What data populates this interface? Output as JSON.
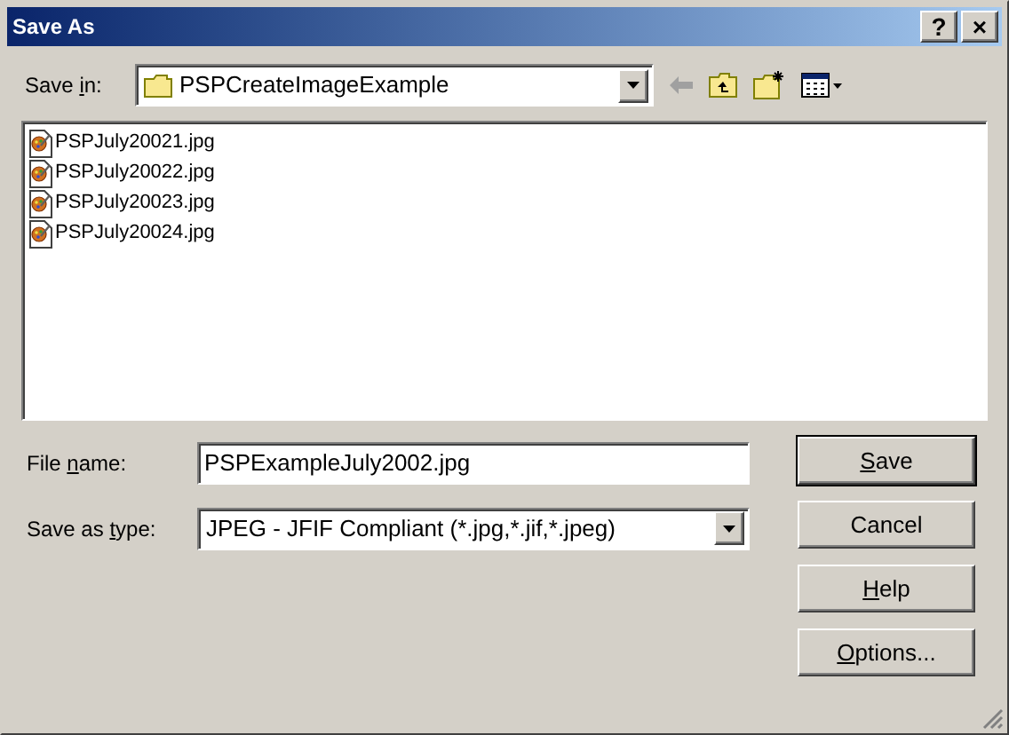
{
  "window": {
    "title": "Save As",
    "title_buttons": [
      "?",
      "×"
    ]
  },
  "save_in": {
    "label": {
      "before": "Save ",
      "access_key": "i",
      "after": "n:"
    },
    "value": "PSPCreateImageExample"
  },
  "files": [
    {
      "name": "PSPJuly20021.jpg",
      "selected": false
    },
    {
      "name": "PSPJuly20022.jpg",
      "selected": false
    },
    {
      "name": "PSPJuly20023.jpg",
      "selected": false
    },
    {
      "name": "PSPJuly20024.jpg",
      "selected": false
    }
  ],
  "file_name": {
    "label": {
      "before": "File ",
      "access_key": "n",
      "after": "ame:"
    },
    "value": "PSPExampleJuly2002.jpg"
  },
  "save_as_type": {
    "label": {
      "before": "Save as ",
      "access_key": "t",
      "after": "ype:"
    },
    "value": "JPEG - JFIF Compliant (*.jpg,*.jif,*.jpeg)"
  },
  "buttons": [
    {
      "label": {
        "access_key": "S",
        "after": "ave"
      },
      "default": true
    },
    {
      "label": {
        "before": "Cancel"
      },
      "default": false
    },
    {
      "label": {
        "access_key": "H",
        "after": "elp"
      },
      "default": false
    },
    {
      "label": {
        "access_key": "O",
        "after": "ptions..."
      },
      "default": false
    }
  ]
}
